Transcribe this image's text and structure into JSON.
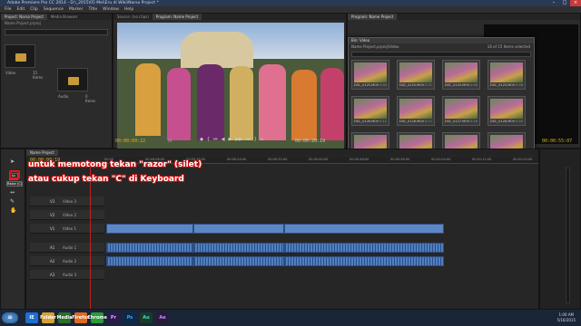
{
  "titlebar": {
    "title": "Adobe Premiere Pro CC 2014 - D:\\_2015\\05 Mei\\Eru di Wiki\\Narso Project *"
  },
  "menu": [
    "File",
    "Edit",
    "Clip",
    "Sequence",
    "Marker",
    "Title",
    "Window",
    "Help"
  ],
  "project_panel": {
    "tabs": [
      "Project: Narso Project",
      "Media Browser",
      "Info",
      "Effects",
      "Markers",
      "History"
    ],
    "search_placeholder": "",
    "path": "Name Project.prproj",
    "items": [
      {
        "name": "Video",
        "count": "15 Items"
      },
      {
        "name": "Audio",
        "count": "0 Items"
      }
    ]
  },
  "source_monitor": {
    "tab": "Source: (no clips)",
    "timecode": "00:00:00:00"
  },
  "program_monitor": {
    "tabs": [
      "Program: Name Project"
    ],
    "timecode_left": "00:00:09:22",
    "fit": "Fit",
    "timecode_right": "00:00:20:19",
    "transport": [
      "◆",
      "{",
      "⏮",
      "◀",
      "▶",
      "▶▶",
      "⏭",
      "}",
      "⌂"
    ]
  },
  "right_monitor": {
    "tab": "Program: Name Project",
    "timecode": "00:00:55:07"
  },
  "bin": {
    "title": "Bin: Video",
    "path": "Name Project.prproj\\Video",
    "selected": "16 of 15 Items selected",
    "footer_name": "Name Project",
    "thumbs": [
      {
        "name": "DSC_0125.MOV",
        "dur": "0:04"
      },
      {
        "name": "DSC_0125.MOV",
        "dur": "0:21"
      },
      {
        "name": "DSC_0125.MOV",
        "dur": "0:06"
      },
      {
        "name": "DSC_0125.MOV",
        "dur": "0:06"
      },
      {
        "name": "DSC_0126.MOV",
        "dur": "0:11"
      },
      {
        "name": "DSC_0126.MOV",
        "dur": "0:11"
      },
      {
        "name": "DSC_0127.MOV",
        "dur": "0:16"
      },
      {
        "name": "DSC_0128.MOV",
        "dur": "0:05"
      },
      {
        "name": "DSC_0131.MOV",
        "dur": "0:03"
      },
      {
        "name": "DSC_0128.MOV",
        "dur": "1:08"
      },
      {
        "name": "DSC_0129.MOV",
        "dur": "0:12"
      },
      {
        "name": "DSC_0129.MOV",
        "dur": "0:16"
      },
      {
        "name": "DSC_0132.MOV",
        "dur": "0:06"
      }
    ]
  },
  "timeline": {
    "tab": "Name Project",
    "timecode": "00:00:00:19",
    "ruler": [
      "00:00",
      "00:00:08:00",
      "00:00:16:00",
      "00:00:24:00",
      "00:00:32:00",
      "00:00:40:00",
      "00:00:48:00",
      "00:00:56:00",
      "00:01:04:00",
      "00:01:12:00",
      "00:01:20:00"
    ],
    "tracks": [
      {
        "id": "V3",
        "name": "Video 3"
      },
      {
        "id": "V2",
        "name": "Video 2"
      },
      {
        "id": "V1",
        "name": "Video 1"
      },
      {
        "id": "A1",
        "name": "Audio 1"
      },
      {
        "id": "A2",
        "name": "Audio 2"
      },
      {
        "id": "A3",
        "name": "Audio 3"
      }
    ]
  },
  "tools_tooltip": "Razor (C)",
  "annotation": {
    "line1": "untuk memotong tekan \"razor\" (silet)",
    "line2": "atau cukup tekan \"C\" di Keyboard"
  },
  "taskbar": {
    "time": "1:00 AM",
    "date": "5/16/2015",
    "apps": [
      "IE",
      "Folder",
      "Media",
      "Firefox",
      "Chrome",
      "Pr",
      "Ps",
      "Au",
      "Ae"
    ]
  },
  "colors": {
    "accent": "#e0b020",
    "annotation": "#c41010",
    "clip": "#5d86c4"
  }
}
